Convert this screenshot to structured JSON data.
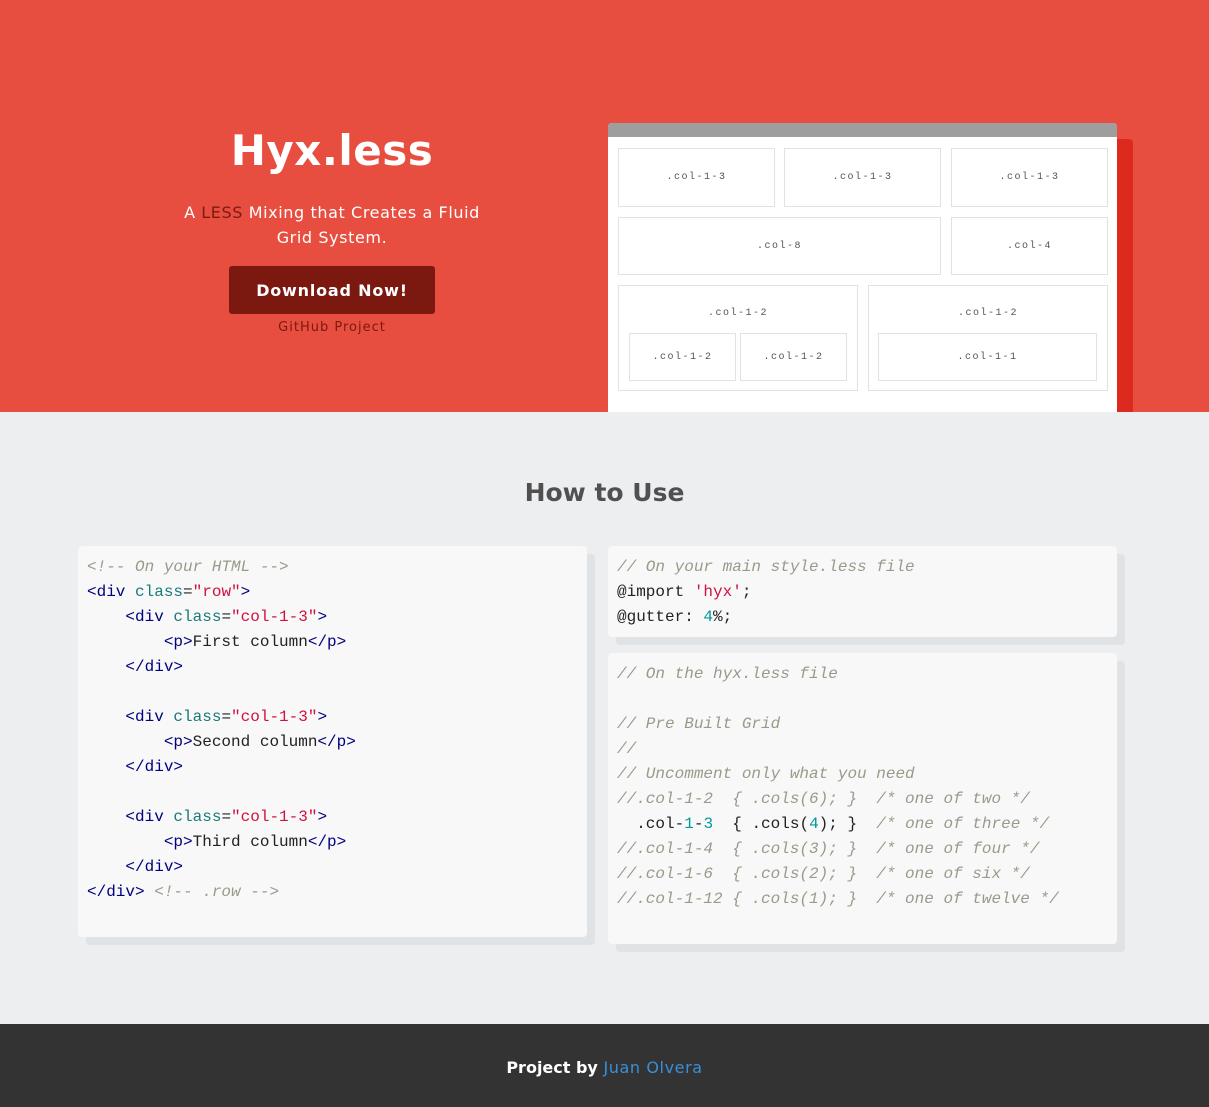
{
  "hero": {
    "title": "Hyx.less",
    "subtitle_prefix": "A ",
    "subtitle_highlight": "LESS",
    "subtitle_rest": " Mixing that Creates a Fluid Grid System.",
    "download_label": "Download Now!",
    "github_label": "GitHub Project",
    "accent_color": "#e84e40",
    "button_color": "#7b1810"
  },
  "grid_demo": {
    "row1": [
      ".col-1-3",
      ".col-1-3",
      ".col-1-3"
    ],
    "row2": [
      ".col-8",
      ".col-4"
    ],
    "row3_left": ".col-1-2",
    "row3_left_children": [
      ".col-1-2",
      ".col-1-2"
    ],
    "row3_right": ".col-1-2",
    "row3_right_children": [
      ".col-1-1"
    ]
  },
  "how_to": {
    "title": "How to Use",
    "html_code": {
      "lines": [
        [
          [
            "c",
            "<!-- On your HTML -->"
          ]
        ],
        [
          [
            "t",
            "<div "
          ],
          [
            "a",
            "class"
          ],
          [
            "p",
            "="
          ],
          [
            "s",
            "\"row\""
          ],
          [
            "t",
            ">"
          ]
        ],
        [
          [
            "p",
            "    "
          ],
          [
            "t",
            "<div "
          ],
          [
            "a",
            "class"
          ],
          [
            "p",
            "="
          ],
          [
            "s",
            "\"col-1-3\""
          ],
          [
            "t",
            ">"
          ]
        ],
        [
          [
            "p",
            "        "
          ],
          [
            "t",
            "<p>"
          ],
          [
            "p",
            "First column"
          ],
          [
            "t",
            "</p>"
          ]
        ],
        [
          [
            "p",
            "    "
          ],
          [
            "t",
            "</div>"
          ]
        ],
        [
          [
            "p",
            ""
          ]
        ],
        [
          [
            "p",
            "    "
          ],
          [
            "t",
            "<div "
          ],
          [
            "a",
            "class"
          ],
          [
            "p",
            "="
          ],
          [
            "s",
            "\"col-1-3\""
          ],
          [
            "t",
            ">"
          ]
        ],
        [
          [
            "p",
            "        "
          ],
          [
            "t",
            "<p>"
          ],
          [
            "p",
            "Second column"
          ],
          [
            "t",
            "</p>"
          ]
        ],
        [
          [
            "p",
            "    "
          ],
          [
            "t",
            "</div>"
          ]
        ],
        [
          [
            "p",
            ""
          ]
        ],
        [
          [
            "p",
            "    "
          ],
          [
            "t",
            "<div "
          ],
          [
            "a",
            "class"
          ],
          [
            "p",
            "="
          ],
          [
            "s",
            "\"col-1-3\""
          ],
          [
            "t",
            ">"
          ]
        ],
        [
          [
            "p",
            "        "
          ],
          [
            "t",
            "<p>"
          ],
          [
            "p",
            "Third column"
          ],
          [
            "t",
            "</p>"
          ]
        ],
        [
          [
            "p",
            "    "
          ],
          [
            "t",
            "</div>"
          ]
        ],
        [
          [
            "t",
            "</div>"
          ],
          [
            "p",
            " "
          ],
          [
            "c",
            "<!-- .row -->"
          ]
        ]
      ]
    },
    "style_code": {
      "lines": [
        [
          [
            "c",
            "// On your main style.less file"
          ]
        ],
        [
          [
            "p",
            "@import "
          ],
          [
            "s",
            "'hyx'"
          ],
          [
            "p",
            ";"
          ]
        ],
        [
          [
            "p",
            "@gutter: "
          ],
          [
            "n",
            "4"
          ],
          [
            "p",
            "%;"
          ]
        ]
      ]
    },
    "hyx_code": {
      "lines": [
        [
          [
            "c",
            "// On the hyx.less file"
          ]
        ],
        [
          [
            "p",
            ""
          ]
        ],
        [
          [
            "c",
            "// Pre Built Grid"
          ]
        ],
        [
          [
            "c",
            "//"
          ]
        ],
        [
          [
            "c",
            "// Uncomment only what you need"
          ]
        ],
        [
          [
            "c",
            "//.col-1-2  { .cols(6); }  /* one of two */"
          ]
        ],
        [
          [
            "p",
            "  .col-"
          ],
          [
            "n",
            "1"
          ],
          [
            "p",
            "-"
          ],
          [
            "n",
            "3"
          ],
          [
            "p",
            "  { .cols("
          ],
          [
            "n",
            "4"
          ],
          [
            "p",
            "); }  "
          ],
          [
            "c",
            "/* one of three */"
          ]
        ],
        [
          [
            "c",
            "//.col-1-4  { .cols(3); }  /* one of four */"
          ]
        ],
        [
          [
            "c",
            "//.col-1-6  { .cols(2); }  /* one of six */"
          ]
        ],
        [
          [
            "c",
            "//.col-1-12 { .cols(1); }  /* one of twelve */"
          ]
        ]
      ]
    }
  },
  "footer": {
    "prefix": "Project by ",
    "author": "Juan Olvera"
  }
}
